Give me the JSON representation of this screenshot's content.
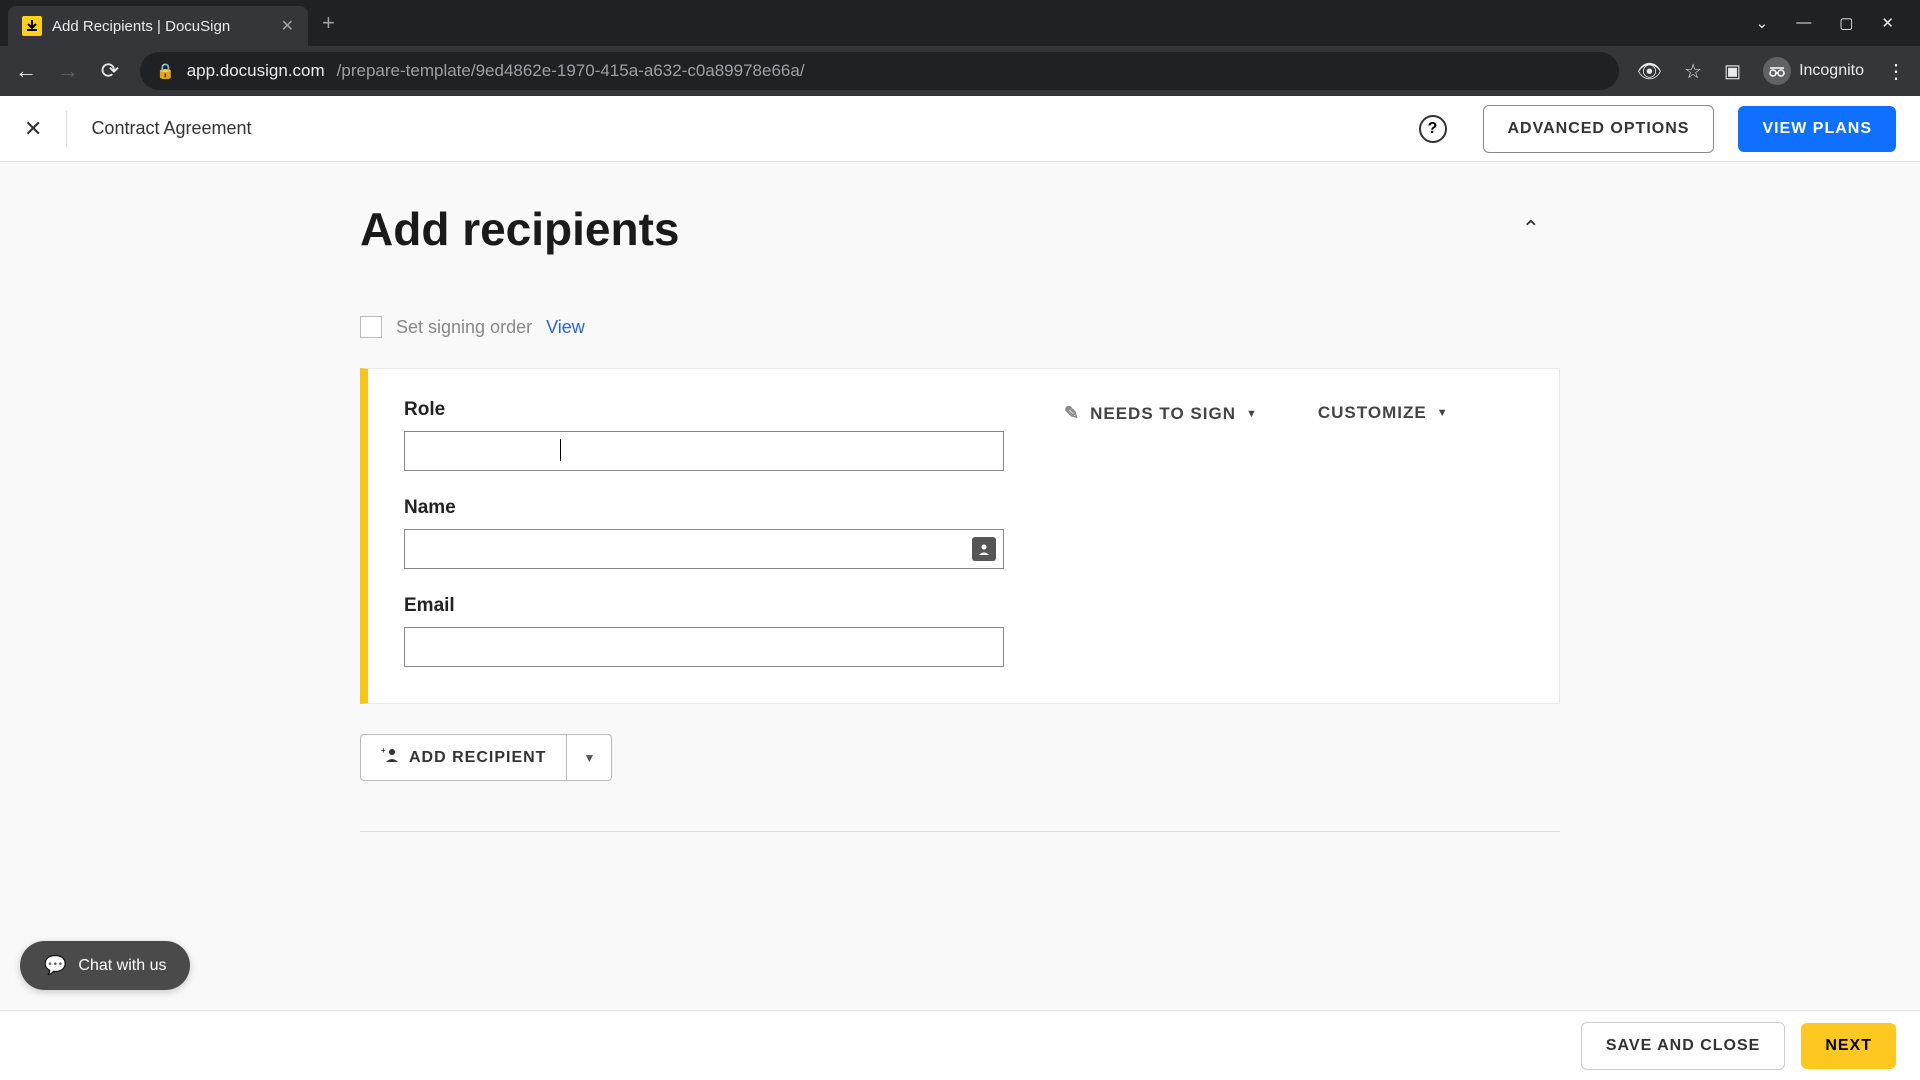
{
  "browser": {
    "tab_title": "Add Recipients | DocuSign",
    "url_host": "app.docusign.com",
    "url_path": "/prepare-template/9ed4862e-1970-415a-a632-c0a89978e66a/",
    "incognito_label": "Incognito"
  },
  "header": {
    "doc_title": "Contract Agreement",
    "advanced_options": "ADVANCED OPTIONS",
    "view_plans": "VIEW PLANS"
  },
  "section": {
    "title": "Add recipients",
    "set_signing_order": "Set signing order",
    "view_link": "View"
  },
  "recipient": {
    "role_label": "Role",
    "role_value": "",
    "name_label": "Name",
    "name_value": "",
    "email_label": "Email",
    "email_value": "",
    "needs_to_sign": "NEEDS TO SIGN",
    "customize": "CUSTOMIZE",
    "accent_color": "#f5c518"
  },
  "add_recipient_btn": "ADD RECIPIENT",
  "footer": {
    "save_close": "SAVE AND CLOSE",
    "next": "NEXT"
  },
  "chat": {
    "label": "Chat with us"
  }
}
